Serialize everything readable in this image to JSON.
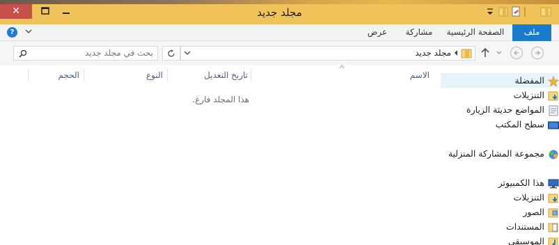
{
  "window": {
    "title": "مجلد جديد"
  },
  "titlebar_buttons": {
    "close": "✕"
  },
  "ribbon": {
    "tabs": [
      {
        "label": "ملف",
        "active": true
      },
      {
        "label": "الصفحة الرئيسية"
      },
      {
        "label": "مشاركة"
      },
      {
        "label": "عرض"
      }
    ],
    "help": "?"
  },
  "address": {
    "crumb": "مجلد جديد",
    "search_placeholder": "بحث في مجلد جديد"
  },
  "columns": [
    "الاسم",
    "تاريخ التعديل",
    "النوع",
    "الحجم"
  ],
  "empty_message": "هذا المجلد فارغ.",
  "navigation": {
    "favorites": {
      "label": "المفضلة",
      "items": [
        "التنزيلات",
        "المواضع حديثة الزيارة",
        "سطح المكتب"
      ]
    },
    "homegroup": {
      "label": "مجموعة المشاركة المنزلية"
    },
    "computer": {
      "label": "هذا الكمبيوتر",
      "items": [
        "التنزيلات",
        "الصور",
        "المستندات",
        "الموسيقى"
      ]
    }
  },
  "colors": {
    "titlebar": "#efc25a",
    "file_tab": "#1979ca",
    "close_button": "#c7504a",
    "column_header_text": "#4c607a",
    "selection": "#e5f3fb"
  }
}
